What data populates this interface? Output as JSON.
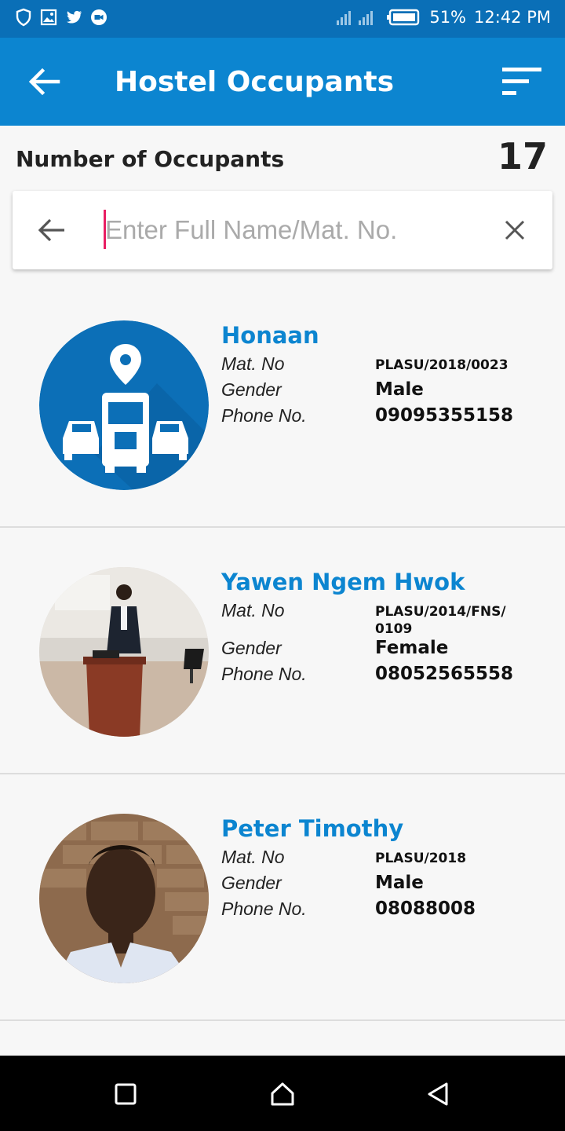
{
  "status_bar": {
    "icons_left": [
      "shield-icon",
      "image-icon",
      "twitter-icon",
      "video-icon"
    ],
    "icons_right": [
      "signal-icon",
      "battery-icon"
    ],
    "battery_text": "51%",
    "time": "12:42 PM"
  },
  "app_bar": {
    "title": "Hostel Occupants",
    "back_icon": "arrow-left-icon",
    "menu_icon": "sort-icon"
  },
  "summary": {
    "label": "Number of Occupants",
    "count": "17"
  },
  "search": {
    "placeholder": "Enter Full Name/Mat. No.",
    "value": ""
  },
  "labels": {
    "mat_no": "Mat. No",
    "gender": "Gender",
    "phone": "Phone No."
  },
  "occupants": [
    {
      "name": "Honaan",
      "mat_no": "PLASU/2018/0023",
      "gender": "Male",
      "phone": "09095355158"
    },
    {
      "name": "Yawen Ngem Hwok",
      "mat_no": "PLASU/2014/FNS/\n0109",
      "gender": "Female",
      "phone": "08052565558"
    },
    {
      "name": "Peter Timothy",
      "mat_no": "PLASU/2018",
      "gender": "Male",
      "phone": "08088008"
    }
  ],
  "colors": {
    "status_bar": "#0a6fb7",
    "app_bar": "#0c85d0",
    "accent": "#e91e63",
    "name": "#0c85d0"
  }
}
